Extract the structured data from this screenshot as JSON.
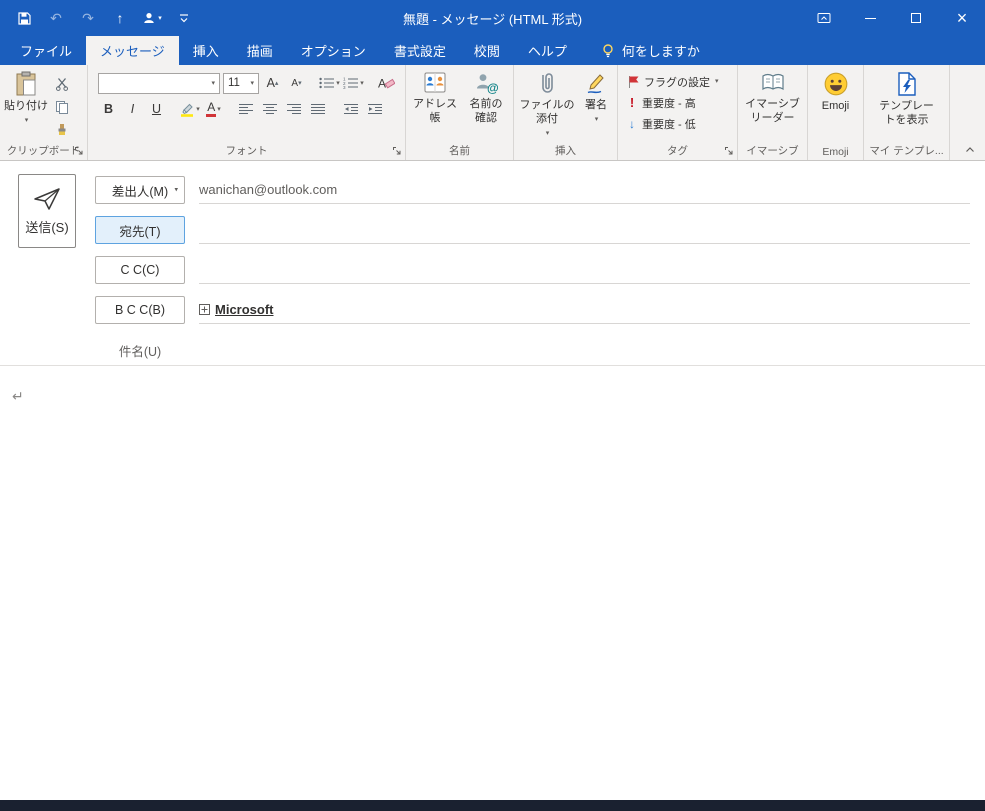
{
  "colors": {
    "titlebar_blue": "#1b5ebd",
    "ribbon_gray": "#f3f2f1",
    "flag_red": "#d13438",
    "high_importance_red": "#c50f1f",
    "low_importance_blue": "#2b7cd3",
    "emoji_yellow": "#ffcd34",
    "to_button_focus": "#e3f0fb"
  },
  "titlebar": {
    "title": "無題 - メッセージ (HTML 形式)"
  },
  "menu": {
    "tabs": [
      {
        "label": "ファイル"
      },
      {
        "label": "メッセージ"
      },
      {
        "label": "挿入"
      },
      {
        "label": "描画"
      },
      {
        "label": "オプション"
      },
      {
        "label": "書式設定"
      },
      {
        "label": "校閲"
      },
      {
        "label": "ヘルプ"
      }
    ],
    "tell_me": "何をしますか"
  },
  "ribbon": {
    "clipboard": {
      "paste_label": "貼り付け",
      "group_label": "クリップボード"
    },
    "font": {
      "font_name_value": "",
      "font_size_value": "11",
      "bold": "B",
      "italic": "I",
      "underline": "U",
      "group_label": "フォント"
    },
    "names": {
      "address_book_label": "アドレス帳",
      "check_names_label": "名前の確認",
      "group_label": "名前"
    },
    "include": {
      "attach_label": "ファイルの添付",
      "signature_label": "署名",
      "group_label": "挿入"
    },
    "tags": {
      "flag_label": "フラグの設定",
      "high_label": "重要度 - 高",
      "low_label": "重要度 - 低",
      "group_label": "タグ"
    },
    "immersive": {
      "reader_label": "イマーシブリーダー",
      "group_label": "イマーシブ"
    },
    "emoji": {
      "emoji_label": "Emoji",
      "group_label": "Emoji"
    },
    "templates": {
      "show_label": "テンプレートを表示",
      "group_label": "マイ テンプレ..."
    }
  },
  "compose": {
    "send_label": "送信(S)",
    "from_label": "差出人(M)",
    "from_value": "wanichan@outlook.com",
    "to_label": "宛先(T)",
    "cc_label": "C C(C)",
    "bcc_label": "B C C(B)",
    "bcc_value": "Microsoft",
    "subject_label": "件名(U)"
  },
  "editor": {
    "paragraph_mark": "↵"
  }
}
